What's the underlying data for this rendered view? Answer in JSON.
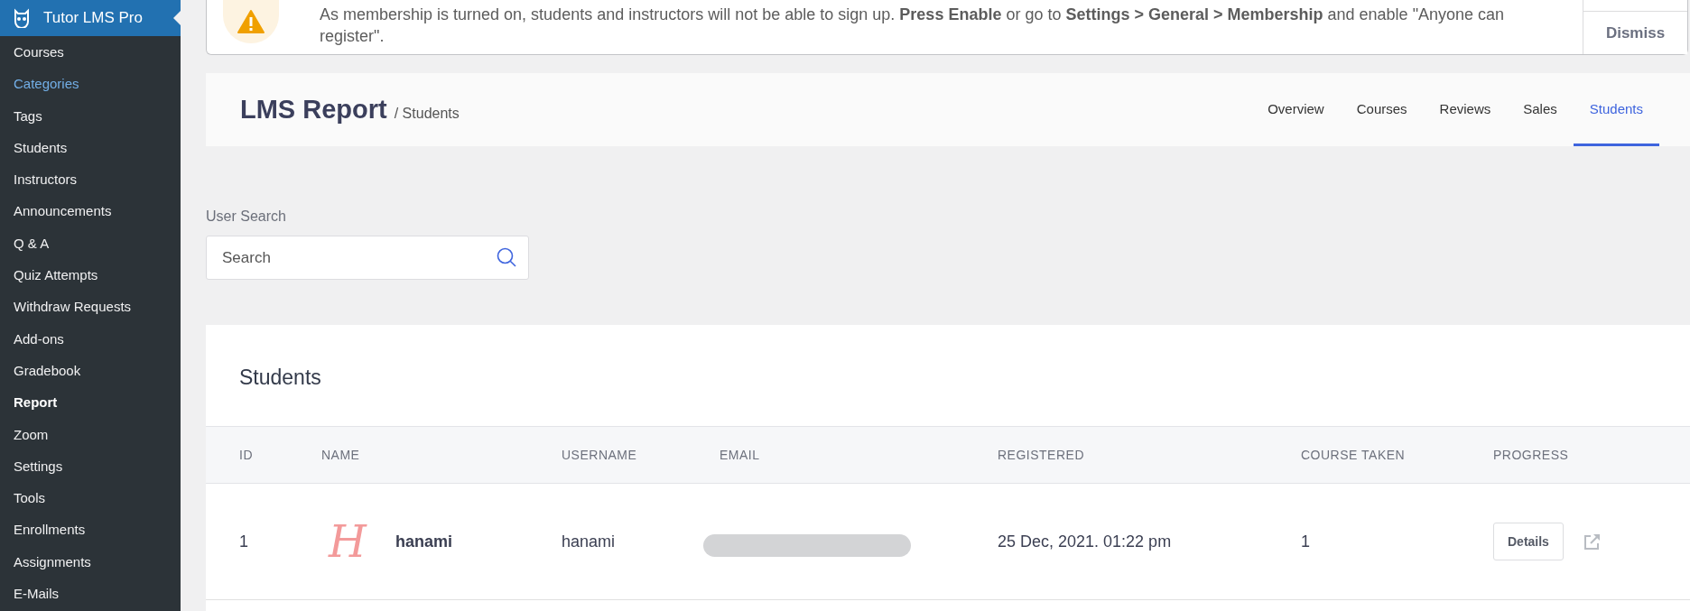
{
  "sidebar": {
    "brand": "Tutor LMS Pro",
    "items": [
      {
        "label": "Courses",
        "selected": false,
        "hovered": false
      },
      {
        "label": "Categories",
        "selected": false,
        "hovered": true
      },
      {
        "label": "Tags",
        "selected": false,
        "hovered": false
      },
      {
        "label": "Students",
        "selected": false,
        "hovered": false
      },
      {
        "label": "Instructors",
        "selected": false,
        "hovered": false
      },
      {
        "label": "Announcements",
        "selected": false,
        "hovered": false
      },
      {
        "label": "Q & A",
        "selected": false,
        "hovered": false
      },
      {
        "label": "Quiz Attempts",
        "selected": false,
        "hovered": false
      },
      {
        "label": "Withdraw Requests",
        "selected": false,
        "hovered": false
      },
      {
        "label": "Add-ons",
        "selected": false,
        "hovered": false
      },
      {
        "label": "Gradebook",
        "selected": false,
        "hovered": false
      },
      {
        "label": "Report",
        "selected": true,
        "hovered": false
      },
      {
        "label": "Zoom",
        "selected": false,
        "hovered": false
      },
      {
        "label": "Settings",
        "selected": false,
        "hovered": false
      },
      {
        "label": "Tools",
        "selected": false,
        "hovered": false
      },
      {
        "label": "Enrollments",
        "selected": false,
        "hovered": false
      },
      {
        "label": "Assignments",
        "selected": false,
        "hovered": false
      },
      {
        "label": "E-Mails",
        "selected": false,
        "hovered": false
      }
    ]
  },
  "notice": {
    "text": "As membership is turned on, students and instructors will not be able to sign up. **Press Enable** or go to **Settings > General > Membership** and enable \"Anyone can register\".",
    "button": "Dismiss"
  },
  "header": {
    "title": "LMS Report",
    "breadcrumb": "/ Students",
    "tabs": [
      {
        "label": "Overview",
        "selected": false
      },
      {
        "label": "Courses",
        "selected": false
      },
      {
        "label": "Reviews",
        "selected": false
      },
      {
        "label": "Sales",
        "selected": false
      },
      {
        "label": "Students",
        "selected": true
      }
    ]
  },
  "search": {
    "label": "User Search",
    "placeholder": "Search"
  },
  "students": {
    "title": "Students",
    "columns": [
      "ID",
      "NAME",
      "USERNAME",
      "EMAIL",
      "REGISTERED",
      "COURSE TAKEN",
      "PROGRESS"
    ],
    "rows": [
      {
        "id": "1",
        "avatar": "H",
        "name": "hanami",
        "username": "hanami",
        "email_redacted": true,
        "registered": "25 Dec, 2021. 01:22 pm",
        "course_taken": "1",
        "action": "Details"
      }
    ]
  }
}
